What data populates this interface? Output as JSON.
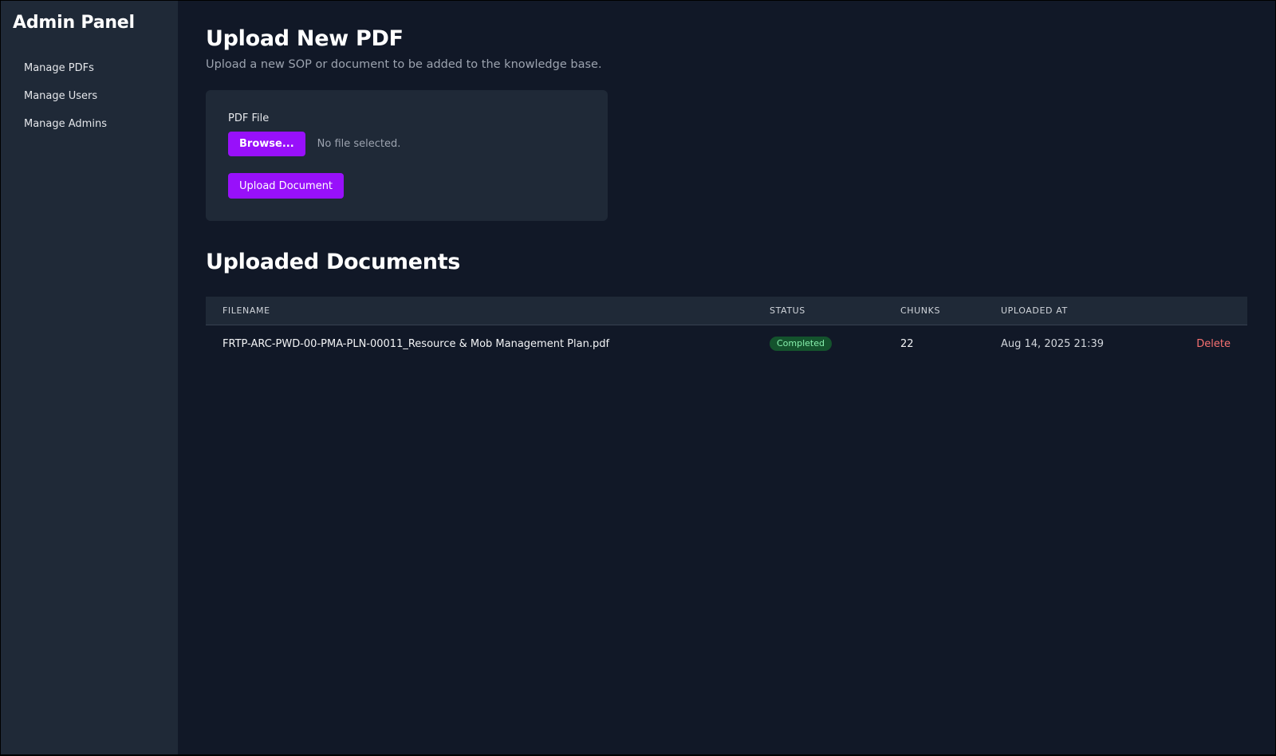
{
  "sidebar": {
    "title": "Admin Panel",
    "items": [
      {
        "label": "Manage PDFs"
      },
      {
        "label": "Manage Users"
      },
      {
        "label": "Manage Admins"
      }
    ]
  },
  "upload": {
    "title": "Upload New PDF",
    "subtitle": "Upload a new SOP or document to be added to the knowledge base.",
    "field_label": "PDF File",
    "browse_label": "Browse...",
    "file_status": "No file selected.",
    "submit_label": "Upload Document"
  },
  "documents": {
    "title": "Uploaded Documents",
    "columns": [
      "Filename",
      "Status",
      "Chunks",
      "Uploaded At"
    ],
    "rows": [
      {
        "filename": "FRTP-ARC-PWD-00-PMA-PLN-00011_Resource & Mob Management Plan.pdf",
        "status": "Completed",
        "chunks": "22",
        "uploaded_at": "Aug 14, 2025 21:39",
        "action": "Delete"
      }
    ]
  },
  "colors": {
    "accent": "#9810fa",
    "background": "#111827",
    "panel": "#1f2937",
    "success": "#14532d",
    "danger": "#f87171"
  }
}
